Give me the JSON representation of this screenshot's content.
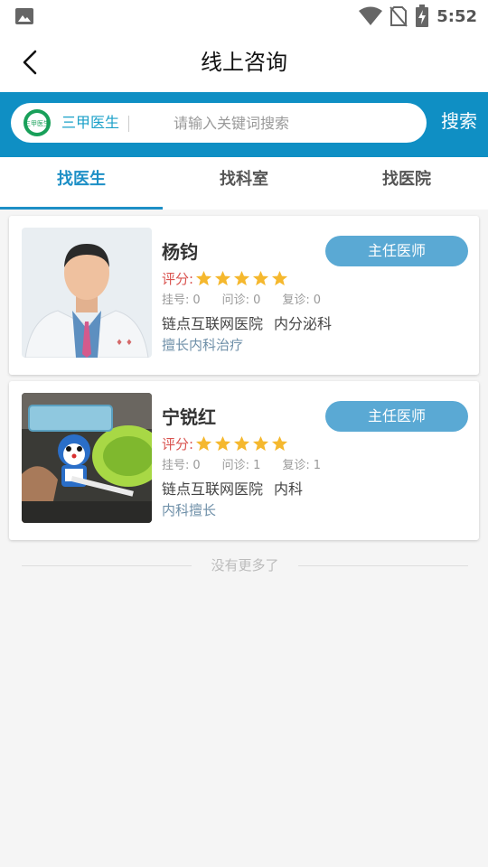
{
  "status_bar": {
    "time": "5:52",
    "icons": [
      "image-notification-icon",
      "wifi-icon",
      "no-sim-icon",
      "battery-charging-icon"
    ]
  },
  "nav": {
    "title": "线上咨询",
    "back_icon": "chevron-left-icon"
  },
  "search": {
    "brand_logo_text": "三甲医生",
    "brand_text": "三甲医生",
    "placeholder": "请输入关键词搜索",
    "value": "",
    "button_label": "搜索",
    "band_color": "#0f8fc4"
  },
  "tabs": [
    {
      "label": "找医生",
      "active": true
    },
    {
      "label": "找科室",
      "active": false
    },
    {
      "label": "找医院",
      "active": false
    }
  ],
  "doctors": [
    {
      "name": "杨钧",
      "title": "主任医师",
      "rating_label": "评分:",
      "stars": 5,
      "stats": [
        {
          "label": "挂号:",
          "value": "0"
        },
        {
          "label": "问诊:",
          "value": "0"
        },
        {
          "label": "复诊:",
          "value": "0"
        }
      ],
      "hospital": "链点互联网医院",
      "department": "内分泌科",
      "specialty": "擅长内科治疗"
    },
    {
      "name": "宁锐红",
      "title": "主任医师",
      "rating_label": "评分:",
      "stars": 5,
      "stats": [
        {
          "label": "挂号:",
          "value": "0"
        },
        {
          "label": "问诊:",
          "value": "1"
        },
        {
          "label": "复诊:",
          "value": "1"
        }
      ],
      "hospital": "链点互联网医院",
      "department": "内科",
      "specialty": "内科擅长"
    }
  ],
  "footer": {
    "end_text": "没有更多了"
  },
  "colors": {
    "accent": "#1d8fc6",
    "badge": "#5aa9d4",
    "star": "#f5b82e",
    "rating_label": "#d9534f"
  }
}
